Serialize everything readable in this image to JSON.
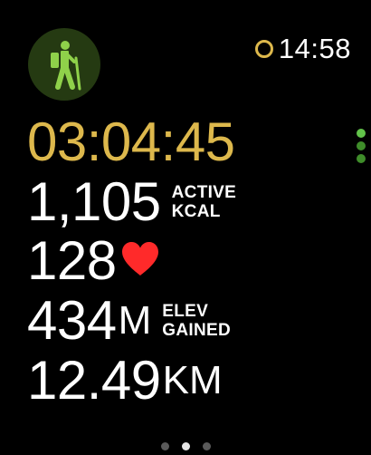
{
  "workout": {
    "icon": "hiker-icon",
    "icon_color": "#8fd14a",
    "icon_bg": "#253a12"
  },
  "status": {
    "time": "14:58",
    "ring_color": "#ddb84c"
  },
  "metrics": {
    "elapsed": "03:04:45",
    "active_kcal": {
      "value": "1,105",
      "label_line1": "ACTIVE",
      "label_line2": "KCAL"
    },
    "heart_rate": {
      "value": "128",
      "icon": "heart-icon",
      "icon_color": "#ff2a2a"
    },
    "elevation": {
      "value": "434",
      "unit": "M",
      "label_line1": "ELEV",
      "label_line2": "GAINED"
    },
    "distance": {
      "value": "12.49",
      "unit": "KM"
    }
  },
  "colors": {
    "accent": "#ddb84c",
    "background": "#000000",
    "text": "#ffffff"
  },
  "pagination": {
    "pages": 3,
    "current": 2
  }
}
